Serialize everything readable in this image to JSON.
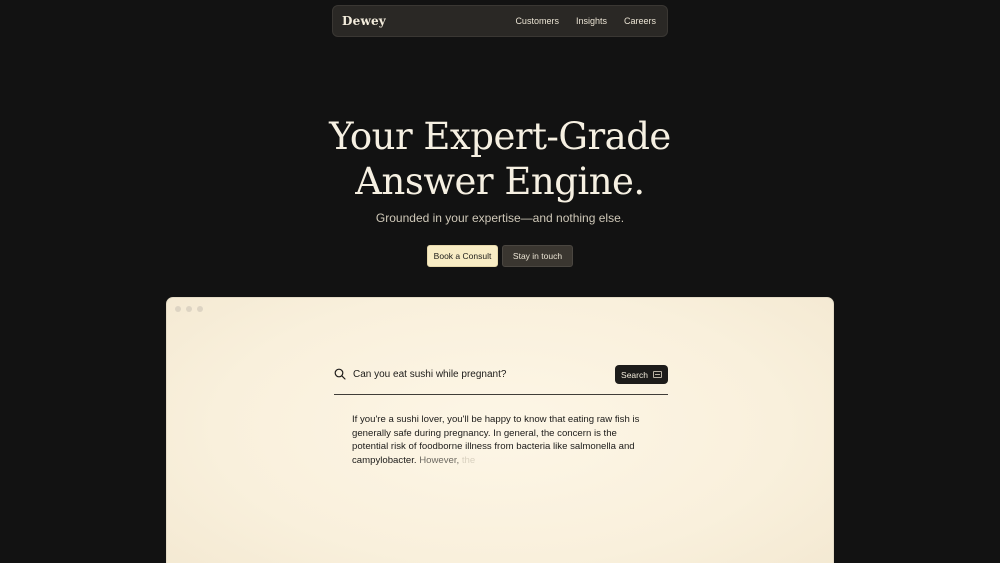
{
  "nav": {
    "logo": "Dewey",
    "links": [
      "Customers",
      "Insights",
      "Careers"
    ]
  },
  "hero": {
    "title_line1": "Your Expert-Grade",
    "title_line2": "Answer Engine.",
    "subtitle": "Grounded in your expertise—and nothing else.",
    "cta_primary": "Book a Consult",
    "cta_secondary": "Stay in touch"
  },
  "demo": {
    "query": "Can you eat sushi while pregnant?",
    "search_button": "Search",
    "answer_text": "If you're a sushi lover, you'll be happy to know that eating raw fish is generally safe during pregnancy. In general, the concern is the potential risk of foodborne illness from bacteria like salmonella and campylobacter.",
    "answer_fade1": "However,",
    "answer_fade2": "the"
  },
  "colors": {
    "background": "#121212",
    "nav_bg": "#2a2825",
    "primary_cta": "#f8ecc4",
    "secondary_cta": "#3a3630",
    "window_bg": "#fbf3e2",
    "search_button_bg": "#1d1c1a"
  },
  "icons": {
    "search": "search-icon",
    "window_controls": "window-dots",
    "keyboard_shortcut": "keyboard-icon"
  }
}
